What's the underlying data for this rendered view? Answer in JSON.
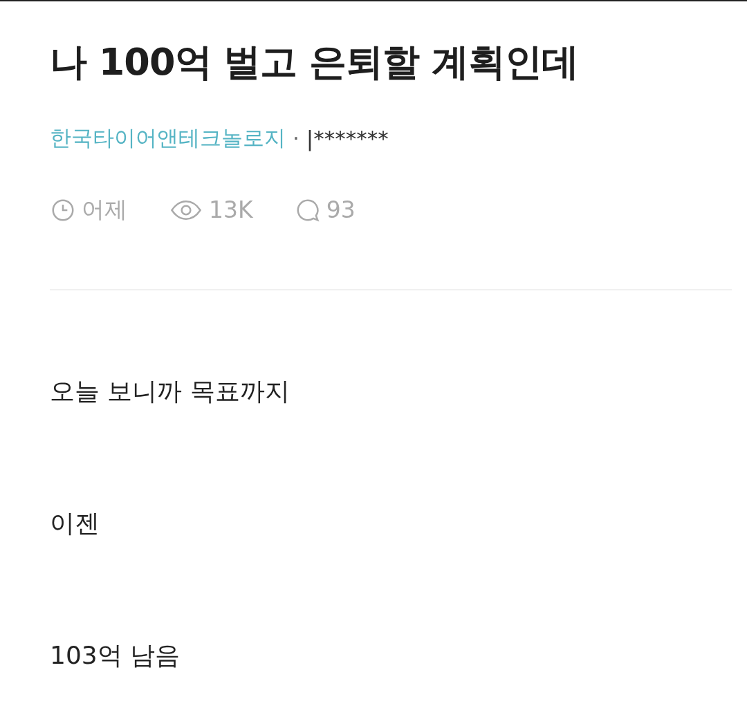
{
  "post": {
    "title": "나 100억 벌고 은퇴할 계획인데",
    "author": {
      "company": "한국타이어앤테크놀로지",
      "separator": "·",
      "nickname": "|*******"
    },
    "meta": [
      {
        "kind": "clock",
        "text": "어제"
      },
      {
        "kind": "eye",
        "text": "13K"
      },
      {
        "kind": "comment",
        "text": "93"
      }
    ],
    "body": [
      "오늘 보니까 목표까지",
      "이젠",
      "103억 남음"
    ]
  }
}
